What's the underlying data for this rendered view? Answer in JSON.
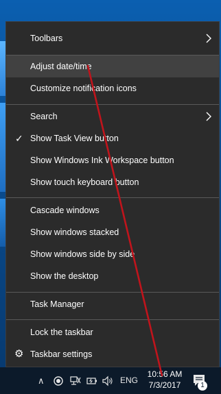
{
  "menu": {
    "items": [
      {
        "label": "Toolbars"
      },
      {
        "label": "Adjust date/time"
      },
      {
        "label": "Customize notification icons"
      },
      {
        "label": "Search"
      },
      {
        "label": "Show Task View button"
      },
      {
        "label": "Show Windows Ink Workspace button"
      },
      {
        "label": "Show touch keyboard button"
      },
      {
        "label": "Cascade windows"
      },
      {
        "label": "Show windows stacked"
      },
      {
        "label": "Show windows side by side"
      },
      {
        "label": "Show the desktop"
      },
      {
        "label": "Task Manager"
      },
      {
        "label": "Lock the taskbar"
      },
      {
        "label": "Taskbar settings"
      }
    ],
    "check_glyph": "✓",
    "gear_glyph": "⚙"
  },
  "tray": {
    "chevron": "∧",
    "language": "ENG",
    "time": "10:56 AM",
    "date": "7/3/2017",
    "notification_count": "1"
  },
  "colors": {
    "menu_bg": "#2b2b2b",
    "highlight": "#414141",
    "annotation": "#c0141c",
    "taskbar": "#0c1a2a"
  }
}
